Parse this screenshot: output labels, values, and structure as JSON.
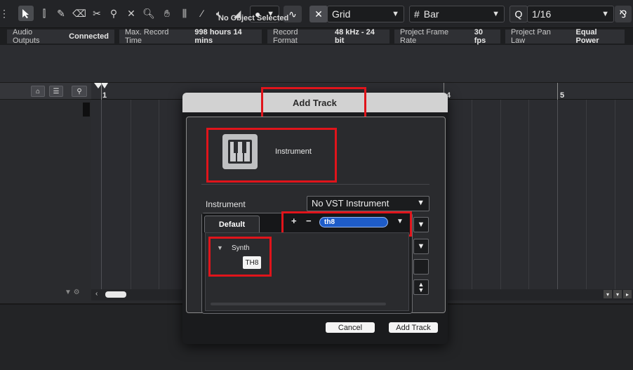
{
  "toolbar": {
    "snap_type": "Grid",
    "grid_type_icon": "#",
    "grid_type": "Bar",
    "quantize_icon": "Q",
    "quantize_value": "1/16",
    "tools": [
      "object-selection",
      "range-selection",
      "draw",
      "erase",
      "split",
      "glue",
      "delete",
      "zoom",
      "mute",
      "time-warp",
      "line",
      "play",
      "color"
    ]
  },
  "infoline": {
    "audio_outputs_label": "Audio Outputs",
    "audio_outputs_value": "Connected",
    "max_record_label": "Max. Record Time",
    "max_record_value": "998 hours 14 mins",
    "record_format_label": "Record Format",
    "record_format_value": "48 kHz - 24 bit",
    "frame_rate_label": "Project Frame Rate",
    "frame_rate_value": "30 fps",
    "pan_law_label": "Project Pan Law",
    "pan_law_value": "Equal Power"
  },
  "inspector": {
    "no_selection": "No Object Selected"
  },
  "ruler": {
    "bars": [
      "1",
      "4",
      "5"
    ]
  },
  "dialog": {
    "title": "Add Track",
    "track_type_label": "Instrument",
    "field_label": "Instrument",
    "vst_selection": "No VST Instrument",
    "tab_label": "Default",
    "search_value": "th8",
    "folder_name": "Synth",
    "plugin_item": "TH8",
    "cancel_label": "Cancel",
    "add_label": "Add Track"
  },
  "colors": {
    "highlight": "#e0141b",
    "search_field": "#1e5cc8"
  }
}
